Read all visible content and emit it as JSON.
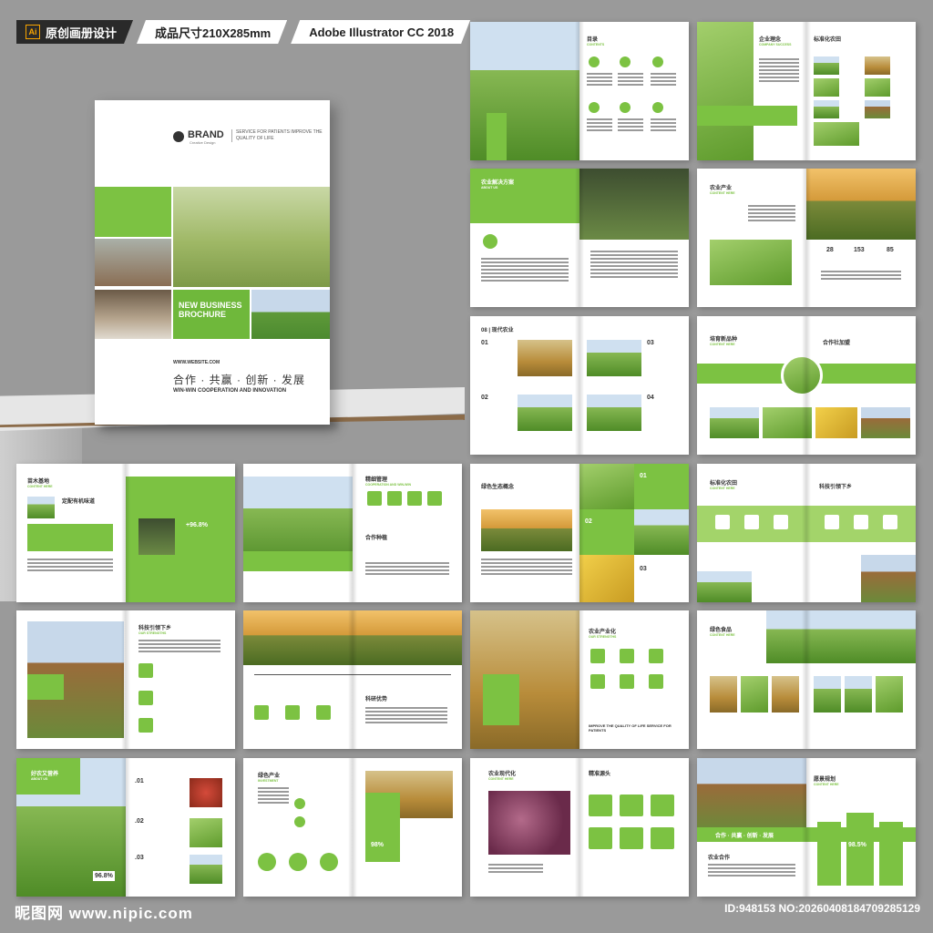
{
  "banner": {
    "ai_label": "Ai",
    "title": "原创画册设计",
    "size": "成品尺寸210X285mm",
    "software": "Adobe Illustrator CC 2018"
  },
  "cover": {
    "brand": "BRAND",
    "brand_sub": "Creative Design",
    "slogan": "SERVICE FOR PATIENTS IMPROVE THE QUALITY OF LIFE",
    "brochure_title": "NEW BUSINESS BROCHURE",
    "website": "WWW.WEBSITE.COM",
    "cn_slogan": "合作 · 共赢 · 创新 · 发展",
    "en_slogan": "WIN-WIN COOPERATION AND INNOVATION"
  },
  "spreads": {
    "s1": {
      "title": "目录",
      "sub": "CONTENTS"
    },
    "s2": {
      "title": "企业理念",
      "sub": "COMPANY SUCCESS",
      "title2": "标准化农田"
    },
    "s3": {
      "title": "农业解决方案",
      "sub": "ABOUT US"
    },
    "s4": {
      "title": "农业产业",
      "sub": "CONTENT HERE",
      "n1": "28",
      "n2": "153",
      "n3": "85"
    },
    "s5": {
      "title": "08 | 现代农业",
      "n1": "01",
      "n2": "02",
      "n3": "03",
      "n4": "04"
    },
    "s6": {
      "title": "培育新品种",
      "sub": "CONTENT HERE",
      "title2": "合作社加盟"
    },
    "s7": {
      "title": "苗木基地",
      "sub": "CONTENT HERE",
      "title2": "定配有机味道",
      "stat": "+96.8%"
    },
    "s8": {
      "title": "精细管理",
      "sub": "COOPERATION AND WIN-WIN",
      "title2": "合作种植"
    },
    "s9": {
      "title": "绿色生态概念",
      "n1": "01",
      "n2": "02",
      "n3": "03"
    },
    "s10": {
      "title": "标准化农田",
      "sub": "CONTENT HERE",
      "title2": "科技引领下乡"
    },
    "s11": {
      "title": "科技引领下乡",
      "sub": "OUR STRENGTHS"
    },
    "s12": {
      "title": "科研优势"
    },
    "s13": {
      "title": "农业产业化",
      "sub": "OUR STRENGTHS",
      "footer": "IMPROVE THE QUALITY OF LIFE SERVICE FOR PATIENTS"
    },
    "s14": {
      "title": "绿色食品",
      "sub": "CONTENT HERE"
    },
    "s15": {
      "title": "好农又营养",
      "sub": "ABOUT US",
      "stat": "96.8%",
      "n1": ".01",
      "n2": ".02",
      "n3": ".03"
    },
    "s16": {
      "title": "绿色产业",
      "sub": "INVESTMENT",
      "stat": "98%"
    },
    "s17": {
      "title": "农业现代化",
      "sub": "CONTENT HERE",
      "title2": "精准源头"
    },
    "s18": {
      "title": "愿景规划",
      "sub": "CONTENT HERE",
      "stat": "98.5%",
      "band": "合作 · 共赢 · 创新 · 发展",
      "title2": "农业合作"
    }
  },
  "footer": {
    "site": "昵图网 www.nipic.com",
    "id": "ID:948153 NO:20260408184709285129"
  }
}
